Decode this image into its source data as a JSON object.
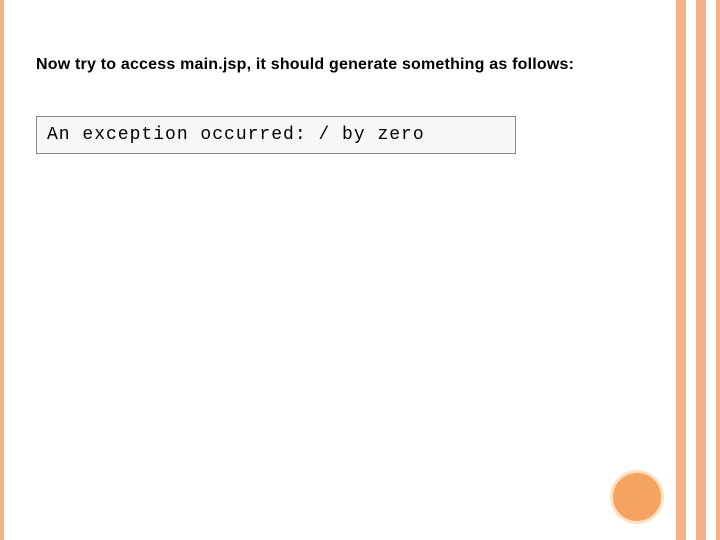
{
  "instruction": "Now try to access main.jsp, it should generate something as follows:",
  "output": "An exception occurred: / by zero",
  "colors": {
    "accent": "#f4b183",
    "circle_fill": "#f4a460",
    "circle_border": "#ffe0c2",
    "box_bg": "#f7f7f7",
    "box_border": "#888888"
  }
}
